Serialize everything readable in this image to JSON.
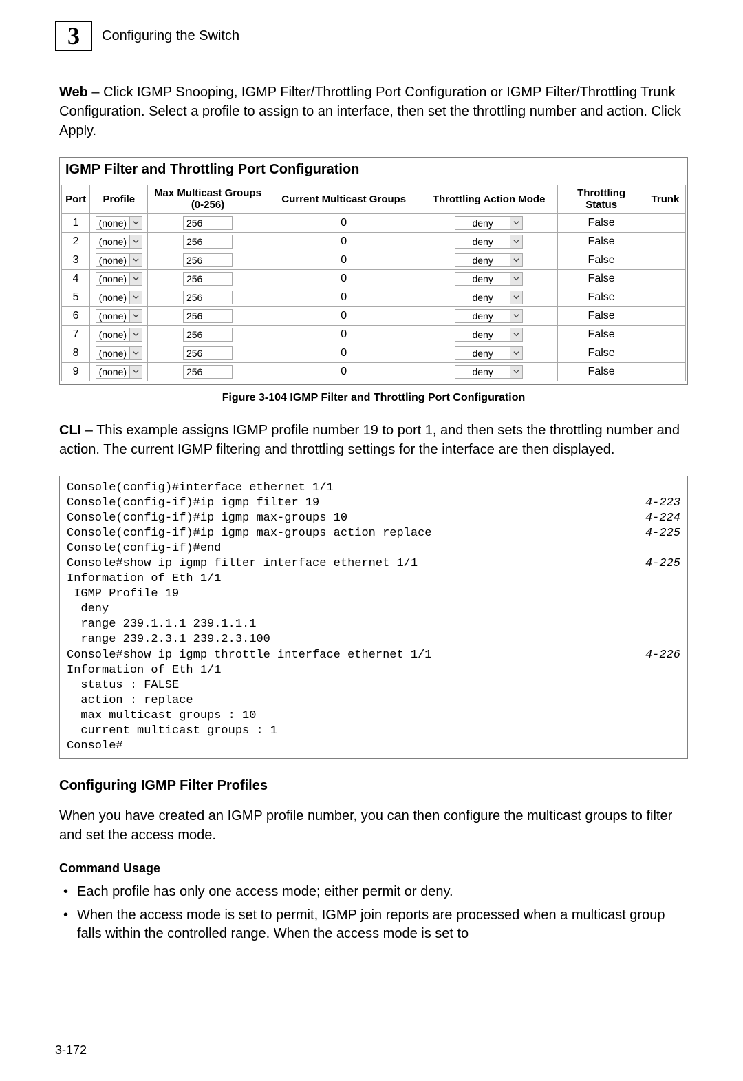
{
  "chapter": {
    "number": "3",
    "title": "Configuring the Switch"
  },
  "intro": {
    "lead": "Web",
    "body": " – Click IGMP Snooping, IGMP Filter/Throttling Port Configuration or IGMP Filter/Throttling Trunk Configuration. Select a profile to assign to an interface, then set the throttling number and action. Click Apply."
  },
  "panel": {
    "title": "IGMP Filter and Throttling Port Configuration",
    "headers": {
      "port": "Port",
      "profile": "Profile",
      "max": "Max Multicast Groups (0-256)",
      "current": "Current Multicast Groups",
      "action": "Throttling Action Mode",
      "status": "Throttling Status",
      "trunk": "Trunk"
    },
    "rows": [
      {
        "port": "1",
        "profile": "(none)",
        "max": "256",
        "current": "0",
        "action": "deny",
        "status": "False",
        "trunk": ""
      },
      {
        "port": "2",
        "profile": "(none)",
        "max": "256",
        "current": "0",
        "action": "deny",
        "status": "False",
        "trunk": ""
      },
      {
        "port": "3",
        "profile": "(none)",
        "max": "256",
        "current": "0",
        "action": "deny",
        "status": "False",
        "trunk": ""
      },
      {
        "port": "4",
        "profile": "(none)",
        "max": "256",
        "current": "0",
        "action": "deny",
        "status": "False",
        "trunk": ""
      },
      {
        "port": "5",
        "profile": "(none)",
        "max": "256",
        "current": "0",
        "action": "deny",
        "status": "False",
        "trunk": ""
      },
      {
        "port": "6",
        "profile": "(none)",
        "max": "256",
        "current": "0",
        "action": "deny",
        "status": "False",
        "trunk": ""
      },
      {
        "port": "7",
        "profile": "(none)",
        "max": "256",
        "current": "0",
        "action": "deny",
        "status": "False",
        "trunk": ""
      },
      {
        "port": "8",
        "profile": "(none)",
        "max": "256",
        "current": "0",
        "action": "deny",
        "status": "False",
        "trunk": ""
      },
      {
        "port": "9",
        "profile": "(none)",
        "max": "256",
        "current": "0",
        "action": "deny",
        "status": "False",
        "trunk": ""
      }
    ]
  },
  "figure_caption": "Figure 3-104  IGMP Filter and Throttling Port Configuration",
  "cli_intro": {
    "lead": "CLI",
    "body": " – This example assigns IGMP profile number 19 to port 1, and then sets the throttling number and action. The current IGMP filtering and throttling settings for the interface are then displayed."
  },
  "cli": [
    {
      "text": "Console(config)#interface ethernet 1/1",
      "ref": ""
    },
    {
      "text": "Console(config-if)#ip igmp filter 19",
      "ref": "4-223"
    },
    {
      "text": "Console(config-if)#ip igmp max-groups 10",
      "ref": "4-224"
    },
    {
      "text": "Console(config-if)#ip igmp max-groups action replace",
      "ref": "4-225"
    },
    {
      "text": "Console(config-if)#end",
      "ref": ""
    },
    {
      "text": "Console#show ip igmp filter interface ethernet 1/1",
      "ref": "4-225"
    },
    {
      "text": "Information of Eth 1/1",
      "ref": ""
    },
    {
      "text": " IGMP Profile 19",
      "ref": ""
    },
    {
      "text": "  deny",
      "ref": ""
    },
    {
      "text": "  range 239.1.1.1 239.1.1.1",
      "ref": ""
    },
    {
      "text": "  range 239.2.3.1 239.2.3.100",
      "ref": ""
    },
    {
      "text": "Console#show ip igmp throttle interface ethernet 1/1",
      "ref": "4-226"
    },
    {
      "text": "Information of Eth 1/1",
      "ref": ""
    },
    {
      "text": "  status : FALSE",
      "ref": ""
    },
    {
      "text": "  action : replace",
      "ref": ""
    },
    {
      "text": "  max multicast groups : 10",
      "ref": ""
    },
    {
      "text": "  current multicast groups : 1",
      "ref": ""
    },
    {
      "text": "Console#",
      "ref": ""
    }
  ],
  "section": {
    "h2": "Configuring IGMP Filter Profiles",
    "p": "When you have created an IGMP profile number, you can then configure the multicast groups to filter and set the access mode.",
    "h3": "Command Usage",
    "bullets": [
      "Each profile has only one access mode; either permit or deny.",
      "When the access mode is set to permit, IGMP join reports are processed when a multicast group falls within the controlled range. When the access mode is set to"
    ]
  },
  "page_number": "3-172"
}
